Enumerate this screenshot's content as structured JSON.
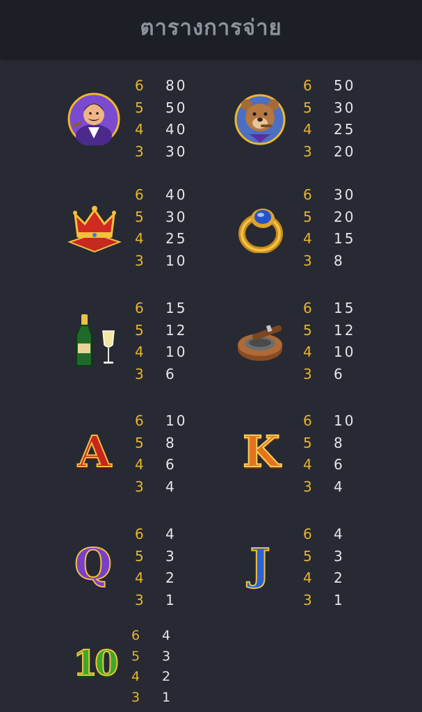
{
  "title": "ตารางการจ่าย",
  "symbols": [
    {
      "name": "mobster-boss",
      "rows": [
        {
          "count": "6",
          "payout": "80"
        },
        {
          "count": "5",
          "payout": "50"
        },
        {
          "count": "4",
          "payout": "40"
        },
        {
          "count": "3",
          "payout": "30"
        }
      ]
    },
    {
      "name": "bear-with-cigar",
      "rows": [
        {
          "count": "6",
          "payout": "50"
        },
        {
          "count": "5",
          "payout": "30"
        },
        {
          "count": "4",
          "payout": "25"
        },
        {
          "count": "3",
          "payout": "20"
        }
      ]
    },
    {
      "name": "crown",
      "rows": [
        {
          "count": "6",
          "payout": "40"
        },
        {
          "count": "5",
          "payout": "30"
        },
        {
          "count": "4",
          "payout": "25"
        },
        {
          "count": "3",
          "payout": "10"
        }
      ]
    },
    {
      "name": "sapphire-ring",
      "rows": [
        {
          "count": "6",
          "payout": "30"
        },
        {
          "count": "5",
          "payout": "20"
        },
        {
          "count": "4",
          "payout": "15"
        },
        {
          "count": "3",
          "payout": "8"
        }
      ]
    },
    {
      "name": "champagne",
      "rows": [
        {
          "count": "6",
          "payout": "15"
        },
        {
          "count": "5",
          "payout": "12"
        },
        {
          "count": "4",
          "payout": "10"
        },
        {
          "count": "3",
          "payout": "6"
        }
      ]
    },
    {
      "name": "cigar-ashtray",
      "rows": [
        {
          "count": "6",
          "payout": "15"
        },
        {
          "count": "5",
          "payout": "12"
        },
        {
          "count": "4",
          "payout": "10"
        },
        {
          "count": "3",
          "payout": "6"
        }
      ]
    },
    {
      "name": "letter-a",
      "glyph": "A",
      "rows": [
        {
          "count": "6",
          "payout": "10"
        },
        {
          "count": "5",
          "payout": "8"
        },
        {
          "count": "4",
          "payout": "6"
        },
        {
          "count": "3",
          "payout": "4"
        }
      ]
    },
    {
      "name": "letter-k",
      "glyph": "K",
      "rows": [
        {
          "count": "6",
          "payout": "10"
        },
        {
          "count": "5",
          "payout": "8"
        },
        {
          "count": "4",
          "payout": "6"
        },
        {
          "count": "3",
          "payout": "4"
        }
      ]
    },
    {
      "name": "letter-q",
      "glyph": "Q",
      "rows": [
        {
          "count": "6",
          "payout": "4"
        },
        {
          "count": "5",
          "payout": "3"
        },
        {
          "count": "4",
          "payout": "2"
        },
        {
          "count": "3",
          "payout": "1"
        }
      ]
    },
    {
      "name": "letter-j",
      "glyph": "J",
      "rows": [
        {
          "count": "6",
          "payout": "4"
        },
        {
          "count": "5",
          "payout": "3"
        },
        {
          "count": "4",
          "payout": "2"
        },
        {
          "count": "3",
          "payout": "1"
        }
      ]
    },
    {
      "name": "number-10",
      "glyph": "10",
      "rows": [
        {
          "count": "6",
          "payout": "4"
        },
        {
          "count": "5",
          "payout": "3"
        },
        {
          "count": "4",
          "payout": "2"
        },
        {
          "count": "3",
          "payout": "1"
        }
      ]
    }
  ]
}
